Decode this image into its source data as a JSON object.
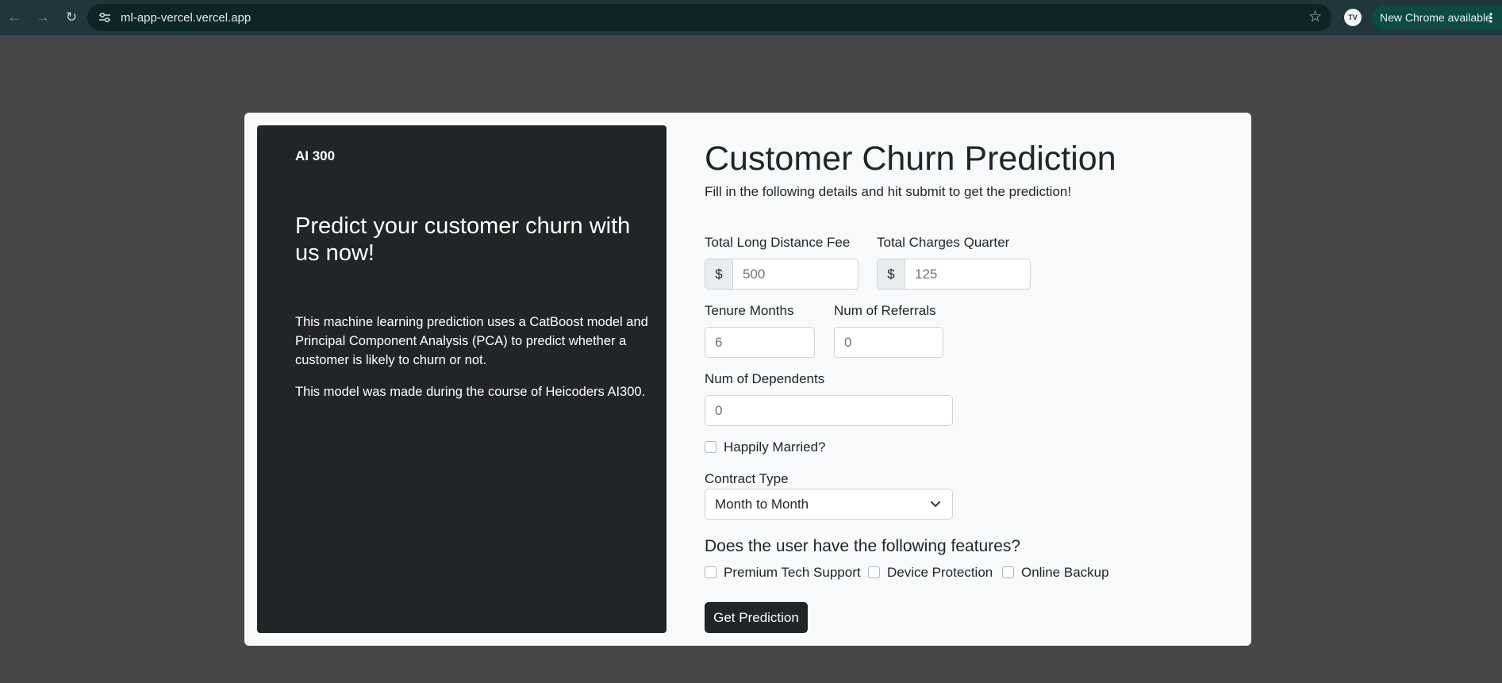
{
  "browser": {
    "url": "ml-app-vercel.vercel.app",
    "update_label": "New Chrome available",
    "profile_initials": "TV"
  },
  "sidebar": {
    "brand": "AI 300",
    "headline": "Predict your customer churn with us now!",
    "description": "This machine learning prediction uses a CatBoost model and Principal Component Analysis (PCA) to predict whether a customer is likely to churn or not.",
    "note": "This model was made during the course of Heicoders AI300."
  },
  "form": {
    "title": "Customer Churn Prediction",
    "subtitle": "Fill in the following details and hit submit to get the prediction!",
    "long_distance": {
      "label": "Total Long Distance Fee",
      "prefix": "$",
      "placeholder": "500"
    },
    "charges_quarter": {
      "label": "Total Charges Quarter",
      "prefix": "$",
      "placeholder": "125"
    },
    "tenure": {
      "label": "Tenure Months",
      "placeholder": "6"
    },
    "referrals": {
      "label": "Num of Referrals",
      "placeholder": "0"
    },
    "dependents": {
      "label": "Num of Dependents",
      "placeholder": "0"
    },
    "married": {
      "label": "Happily Married?",
      "checked": false
    },
    "contract": {
      "label": "Contract Type",
      "selected": "Month to Month"
    },
    "features_heading": "Does the user have the following features?",
    "features": [
      {
        "label": "Premium Tech Support",
        "checked": false
      },
      {
        "label": "Device Protection",
        "checked": false
      },
      {
        "label": "Online Backup",
        "checked": false
      }
    ],
    "submit_label": "Get Prediction"
  },
  "colors": {
    "chrome_bg": "#21363a",
    "page_bg": "#474747",
    "panel_bg": "#212529",
    "card_bg": "#f8f9fa",
    "update_pill": "#0c4a43"
  }
}
